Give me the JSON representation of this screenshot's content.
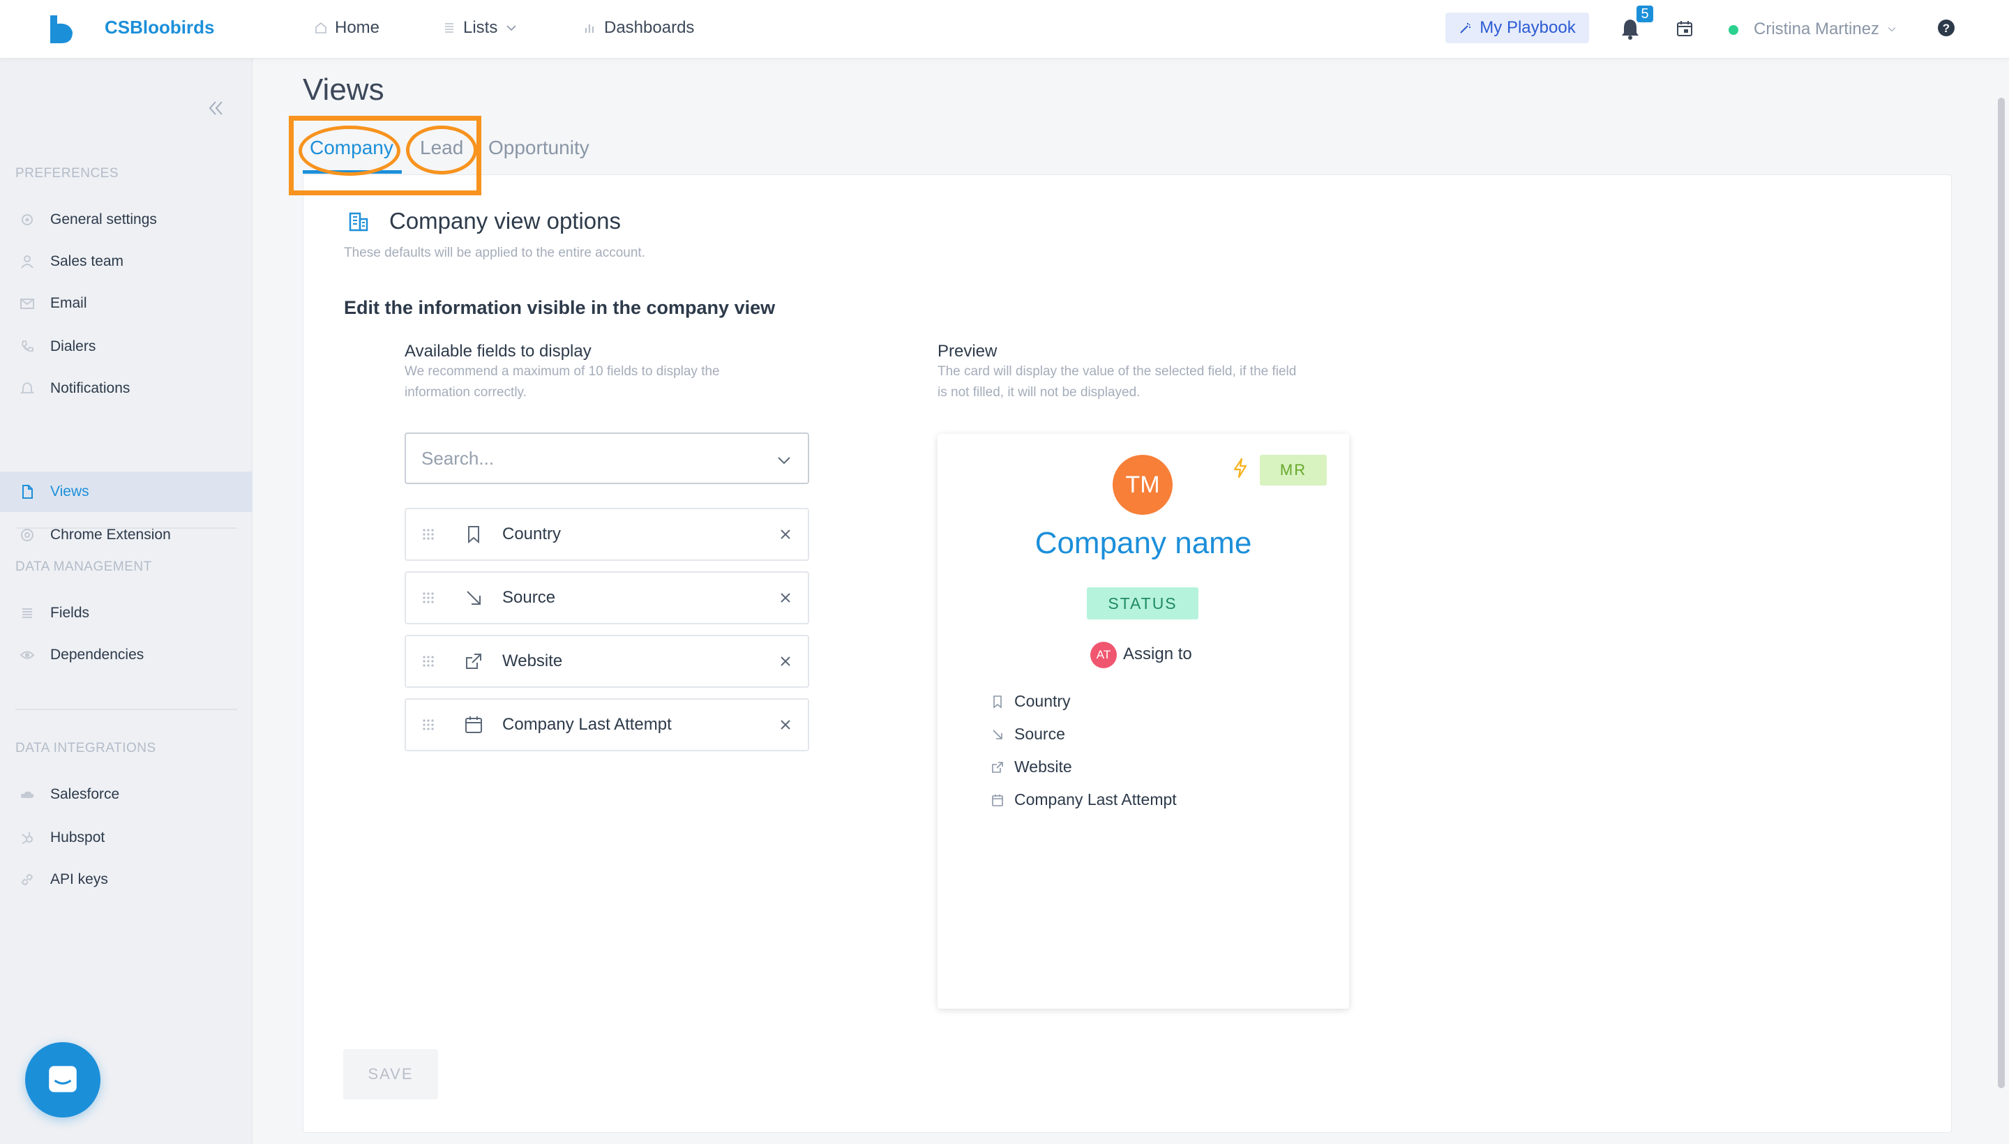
{
  "topbar": {
    "app_name": "CSBloobirds",
    "nav": {
      "home": "Home",
      "lists": "Lists",
      "dashboards": "Dashboards"
    },
    "playbook_label": "My Playbook",
    "notification_count": "5",
    "user_name": "Cristina Martinez"
  },
  "sidebar": {
    "sections": {
      "preferences": "PREFERENCES",
      "data_management": "DATA MANAGEMENT",
      "data_integrations": "DATA INTEGRATIONS"
    },
    "items": {
      "general": "General settings",
      "sales_team": "Sales team",
      "email": "Email",
      "dialers": "Dialers",
      "notifications": "Notifications",
      "views": "Views",
      "chrome": "Chrome Extension",
      "fields": "Fields",
      "dependencies": "Dependencies",
      "salesforce": "Salesforce",
      "hubspot": "Hubspot",
      "api_keys": "API keys"
    },
    "active_item": "views"
  },
  "page": {
    "title": "Views",
    "tabs": {
      "company": "Company",
      "lead": "Lead",
      "opportunity": "Opportunity"
    },
    "active_tab": "company",
    "highlight_color": "#f7931e"
  },
  "card": {
    "title": "Company view options",
    "subtitle": "These defaults will be applied to the entire account.",
    "section_heading": "Edit the information visible in the company view",
    "available": {
      "heading": "Available fields to display",
      "hint_line1": "We recommend a maximum of 10 fields to display the",
      "hint_line2": "information correctly.",
      "search_placeholder": "Search...",
      "fields": {
        "country": "Country",
        "source": "Source",
        "website": "Website",
        "last_attempt": "Company Last Attempt"
      }
    },
    "preview": {
      "heading": "Preview",
      "hint_line1": "The card will display the value of the selected field, if the field",
      "hint_line2": "is not filled, it will not be displayed.",
      "avatar_initials": "TM",
      "badge": "MR",
      "company_name": "Company name",
      "status": "STATUS",
      "assign_initials": "AT",
      "assign_label": "Assign to",
      "fields": {
        "country": "Country",
        "source": "Source",
        "website": "Website",
        "last_attempt": "Company Last Attempt"
      }
    },
    "save_label": "SAVE"
  },
  "colors": {
    "brand": "#1c8fd9",
    "avatar": "#f77f38",
    "status_bg": "#b6f3dc",
    "badge_bg": "#d8f2c0",
    "online": "#2bd18e"
  }
}
